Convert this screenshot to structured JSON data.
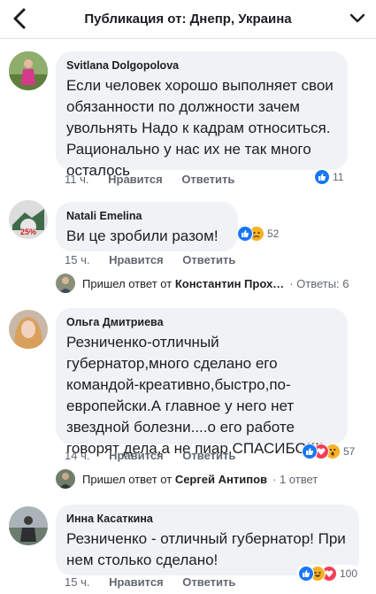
{
  "header": {
    "title": "Публикация от: Днепр, Украина"
  },
  "comments": [
    {
      "author": "Svitlana Dolgopolova",
      "text": "Если человек хорошо выполняет свои обязанности по должности зачем увольнять Надо к кадрам относиться. Рационально у нас их не так много осталось",
      "time": "11 ч.",
      "like": "Нравится",
      "reply": "Ответить",
      "reaction_count": "11",
      "reactions": [
        "like-icon"
      ]
    },
    {
      "author": "Natali Emelina",
      "text": "Ви це зробили разом!",
      "time": "15 ч.",
      "like": "Нравится",
      "reply": "Ответить",
      "reaction_count": "52",
      "reactions": [
        "like-icon",
        "sad-icon"
      ],
      "avatar_badge": "25%",
      "replies_line": {
        "prefix": "Пришел ответ от",
        "name": "Константин Прох…",
        "count": "· Ответы: 6"
      }
    },
    {
      "author": "Ольга Дмитриева",
      "text": "Резниченко-отличный губернатор,много сделано  его командой-креативно,быстро,по-европейски.А главное у него нет звездной болезни....о его работе говорят дела,а не пиар.СПАСИБО!!!!",
      "time": "14 ч.",
      "like": "Нравится",
      "reply": "Ответить",
      "reaction_count": "57",
      "reactions": [
        "like-icon",
        "love-icon",
        "wow-icon"
      ],
      "replies_line": {
        "prefix": "Пришел ответ от",
        "name": "Сергей Антипов",
        "count": "· 1 ответ"
      }
    },
    {
      "author": "Инна Касаткина",
      "text": "Резниченко - отличный губернатор! При нем столько сделано!",
      "time": "15 ч.",
      "like": "Нравится",
      "reply": "Ответить",
      "reaction_count": "100",
      "reactions": [
        "like-icon",
        "haha-icon",
        "love-icon"
      ]
    }
  ],
  "colors": {
    "like_blue": "#1877f2",
    "love_red": "#f33e58",
    "emoji_yellow": "#f7b125",
    "bubble": "#f0f2f5",
    "meta": "#606770"
  }
}
